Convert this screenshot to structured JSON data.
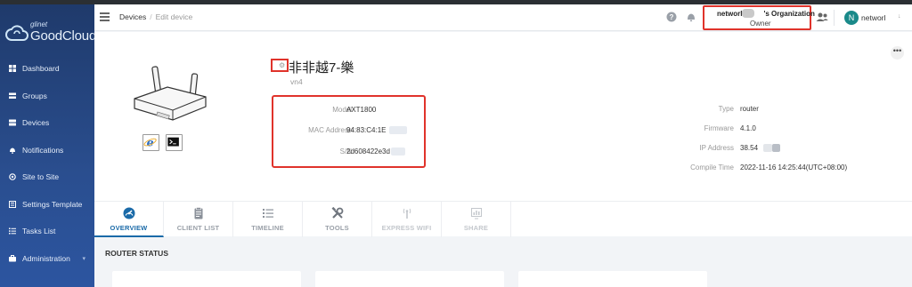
{
  "sidebar": {
    "logo_small": "glinet",
    "logo_big": "GoodCloud",
    "items": [
      {
        "label": "Dashboard",
        "icon": "dashboard-icon"
      },
      {
        "label": "Groups",
        "icon": "groups-icon"
      },
      {
        "label": "Devices",
        "icon": "devices-icon"
      },
      {
        "label": "Notifications",
        "icon": "notifications-icon"
      },
      {
        "label": "Site to Site",
        "icon": "site-to-site-icon"
      },
      {
        "label": "Settings Template",
        "icon": "settings-template-icon"
      },
      {
        "label": "Tasks List",
        "icon": "tasks-list-icon"
      },
      {
        "label": "Administration",
        "icon": "administration-icon"
      }
    ]
  },
  "header": {
    "breadcrumb_root": "Devices",
    "breadcrumb_sep": "/",
    "breadcrumb_current": "Edit device",
    "org_name_left": "networl",
    "org_name_right": "'s Organization",
    "org_role": "Owner",
    "avatar_letter": "N",
    "user_name": "networl",
    "caret": "↓"
  },
  "device": {
    "name": "非非越7-樂",
    "subtitle": "vn4",
    "model_label": "Model",
    "model": "AXT1800",
    "mac_label": "MAC Address",
    "mac": "94:83:C4:1E",
    "sn_label": "S/N",
    "sn": "2d608422e3d",
    "type_label": "Type",
    "type": "router",
    "firmware_label": "Firmware",
    "firmware": "4.1.0",
    "ip_label": "IP Address",
    "ip": "38.54",
    "compile_label": "Compile Time",
    "compile": "2022-11-16 14:25:44(UTC+08:00)",
    "more": "•••"
  },
  "tabs": [
    {
      "label": "OVERVIEW",
      "icon": "gauge-icon",
      "state": "active"
    },
    {
      "label": "CLIENT LIST",
      "icon": "clipboard-icon",
      "state": "normal"
    },
    {
      "label": "TIMELINE",
      "icon": "list-icon",
      "state": "normal"
    },
    {
      "label": "TOOLS",
      "icon": "tools-icon",
      "state": "normal"
    },
    {
      "label": "EXPRESS WIFI",
      "icon": "wifi-antenna-icon",
      "state": "disabled"
    },
    {
      "label": "SHARE",
      "icon": "share-chart-icon",
      "state": "disabled"
    }
  ],
  "section": {
    "title": "ROUTER STATUS"
  },
  "colors": {
    "accent": "#1a6aa8",
    "highlight": "#e0332b",
    "sidebar": "#2a4e8f"
  }
}
